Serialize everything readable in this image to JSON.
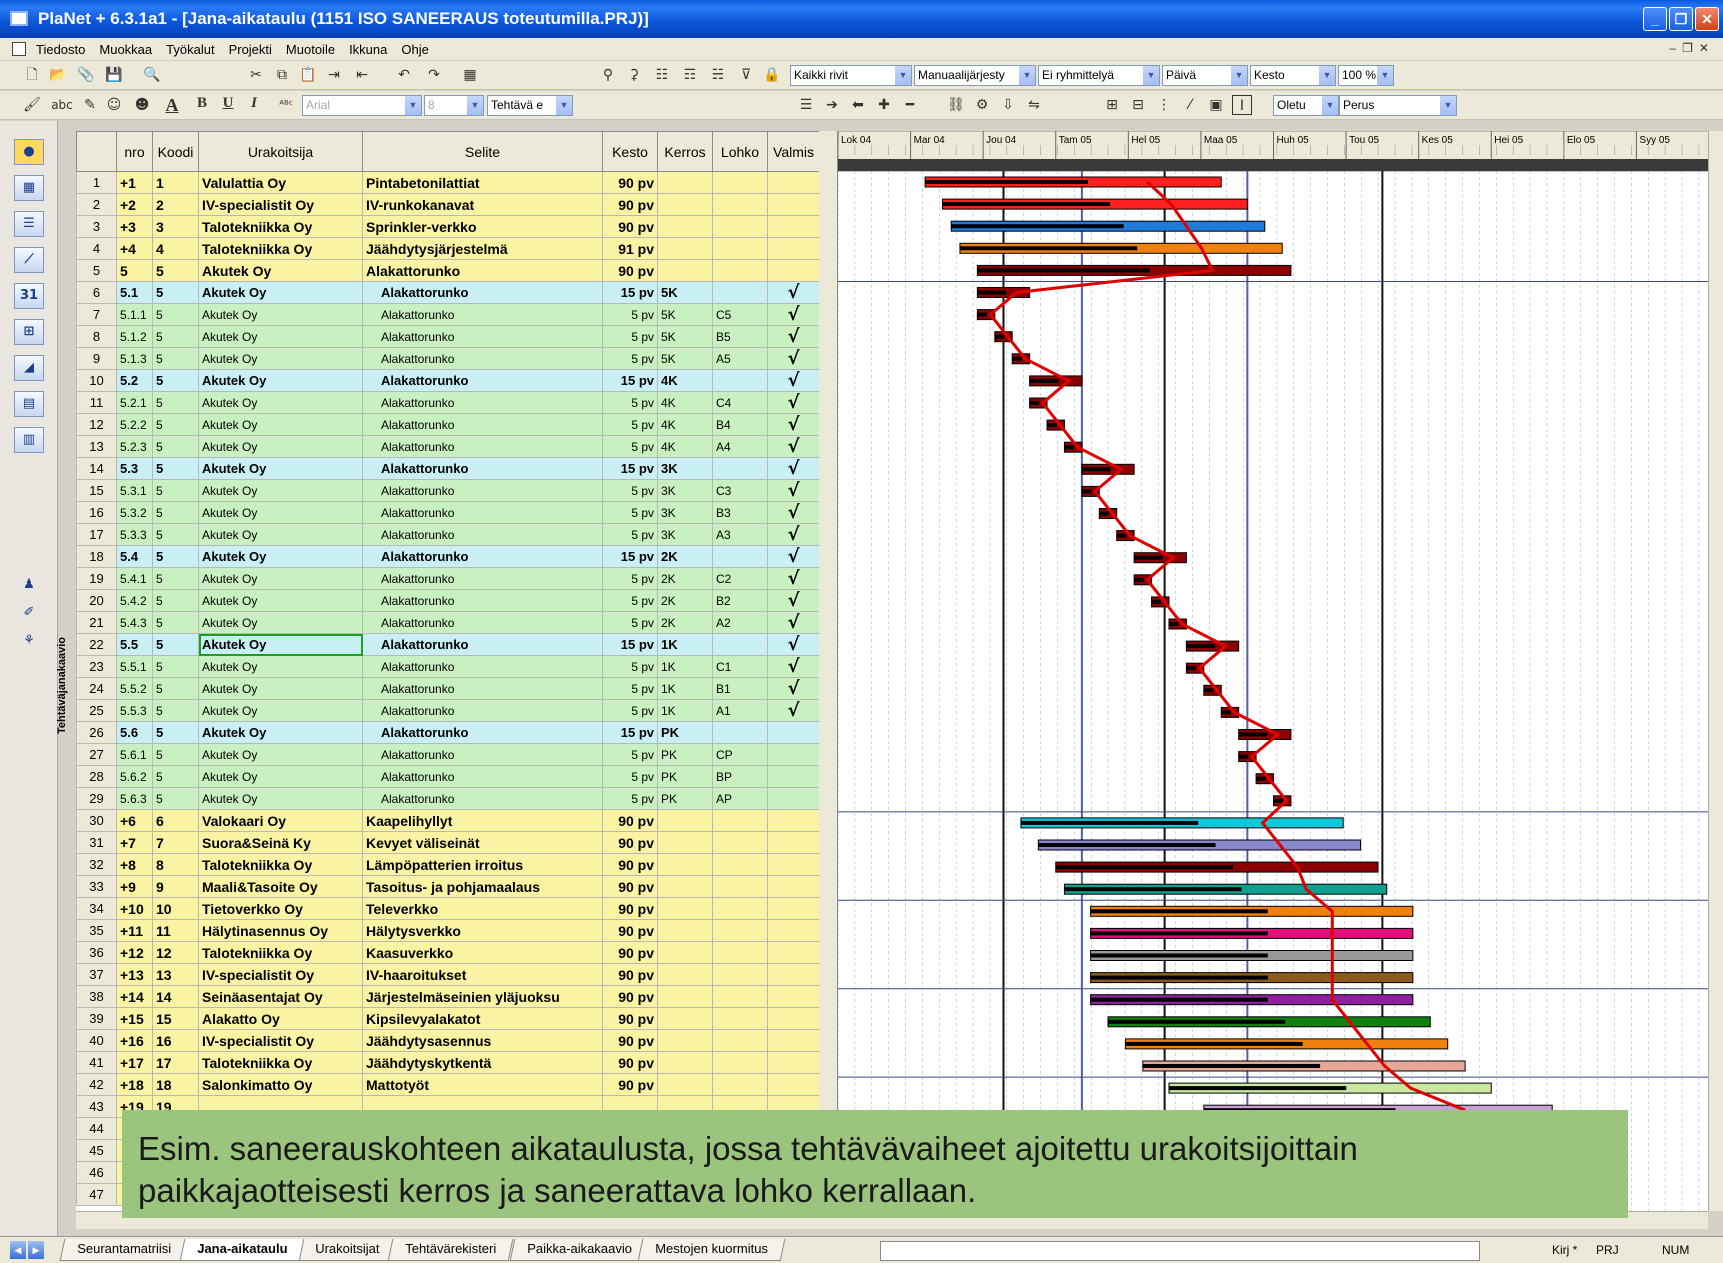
{
  "window": {
    "title": "PlaNet + 6.3.1a1 - [Jana-aikataulu (1151 ISO SANEERAUS toteutumilla.PRJ)]"
  },
  "menu": [
    "Tiedosto",
    "Muokkaa",
    "Työkalut",
    "Projekti",
    "Muotoile",
    "Ikkuna",
    "Ohje"
  ],
  "toolbar": {
    "rows_filter": "Kaikki rivit",
    "order": "Manuaalijärjesty",
    "grouping": "Ei ryhmittelyä",
    "time_unit": "Päivä",
    "column": "Kesto",
    "zoom": "100 %",
    "font": "Arial",
    "font_size": "8",
    "task_field": "Tehtävä e",
    "default_style": "Oletu",
    "base": "Perus"
  },
  "side_label": "Tehtäväjanakaavio",
  "table": {
    "headers": [
      "nro",
      "Koodi",
      "Urakoitsija",
      "Selite",
      "Kesto",
      "Kerros",
      "Lohko",
      "Valmis"
    ],
    "rows": [
      {
        "n": "1",
        "nro": "+1",
        "koodi": "1",
        "urak": "Valulattia Oy",
        "selite": "Pintabetonilattiat",
        "kesto": "90 pv",
        "kerros": "",
        "lohko": "",
        "valmis": "",
        "t": "main"
      },
      {
        "n": "2",
        "nro": "+2",
        "koodi": "2",
        "urak": "IV-specialistit Oy",
        "selite": "IV-runkokanavat",
        "kesto": "90 pv",
        "kerros": "",
        "lohko": "",
        "valmis": "",
        "t": "main"
      },
      {
        "n": "3",
        "nro": "+3",
        "koodi": "3",
        "urak": "Talotekniikka Oy",
        "selite": "Sprinkler-verkko",
        "kesto": "90 pv",
        "kerros": "",
        "lohko": "",
        "valmis": "",
        "t": "main"
      },
      {
        "n": "4",
        "nro": "+4",
        "koodi": "4",
        "urak": "Talotekniikka Oy",
        "selite": "Jäähdytysjärjestelmä",
        "kesto": "91 pv",
        "kerros": "",
        "lohko": "",
        "valmis": "",
        "t": "main"
      },
      {
        "n": "5",
        "nro": "5",
        "koodi": "5",
        "urak": "Akutek Oy",
        "selite": "Alakattorunko",
        "kesto": "90 pv",
        "kerros": "",
        "lohko": "",
        "valmis": "",
        "t": "main"
      },
      {
        "n": "6",
        "nro": "5.1",
        "koodi": "5",
        "urak": "Akutek Oy",
        "selite": "Alakattorunko",
        "kesto": "15 pv",
        "kerros": "5K",
        "lohko": "",
        "valmis": "√",
        "t": "group"
      },
      {
        "n": "7",
        "nro": "5.1.1",
        "koodi": "5",
        "urak": "Akutek Oy",
        "selite": "Alakattorunko",
        "kesto": "5 pv",
        "kerros": "5K",
        "lohko": "C5",
        "valmis": "√",
        "t": "sub"
      },
      {
        "n": "8",
        "nro": "5.1.2",
        "koodi": "5",
        "urak": "Akutek Oy",
        "selite": "Alakattorunko",
        "kesto": "5 pv",
        "kerros": "5K",
        "lohko": "B5",
        "valmis": "√",
        "t": "sub"
      },
      {
        "n": "9",
        "nro": "5.1.3",
        "koodi": "5",
        "urak": "Akutek Oy",
        "selite": "Alakattorunko",
        "kesto": "5 pv",
        "kerros": "5K",
        "lohko": "A5",
        "valmis": "√",
        "t": "sub"
      },
      {
        "n": "10",
        "nro": "5.2",
        "koodi": "5",
        "urak": "Akutek Oy",
        "selite": "Alakattorunko",
        "kesto": "15 pv",
        "kerros": "4K",
        "lohko": "",
        "valmis": "√",
        "t": "group"
      },
      {
        "n": "11",
        "nro": "5.2.1",
        "koodi": "5",
        "urak": "Akutek Oy",
        "selite": "Alakattorunko",
        "kesto": "5 pv",
        "kerros": "4K",
        "lohko": "C4",
        "valmis": "√",
        "t": "sub"
      },
      {
        "n": "12",
        "nro": "5.2.2",
        "koodi": "5",
        "urak": "Akutek Oy",
        "selite": "Alakattorunko",
        "kesto": "5 pv",
        "kerros": "4K",
        "lohko": "B4",
        "valmis": "√",
        "t": "sub"
      },
      {
        "n": "13",
        "nro": "5.2.3",
        "koodi": "5",
        "urak": "Akutek Oy",
        "selite": "Alakattorunko",
        "kesto": "5 pv",
        "kerros": "4K",
        "lohko": "A4",
        "valmis": "√",
        "t": "sub"
      },
      {
        "n": "14",
        "nro": "5.3",
        "koodi": "5",
        "urak": "Akutek Oy",
        "selite": "Alakattorunko",
        "kesto": "15 pv",
        "kerros": "3K",
        "lohko": "",
        "valmis": "√",
        "t": "group"
      },
      {
        "n": "15",
        "nro": "5.3.1",
        "koodi": "5",
        "urak": "Akutek Oy",
        "selite": "Alakattorunko",
        "kesto": "5 pv",
        "kerros": "3K",
        "lohko": "C3",
        "valmis": "√",
        "t": "sub"
      },
      {
        "n": "16",
        "nro": "5.3.2",
        "koodi": "5",
        "urak": "Akutek Oy",
        "selite": "Alakattorunko",
        "kesto": "5 pv",
        "kerros": "3K",
        "lohko": "B3",
        "valmis": "√",
        "t": "sub"
      },
      {
        "n": "17",
        "nro": "5.3.3",
        "koodi": "5",
        "urak": "Akutek Oy",
        "selite": "Alakattorunko",
        "kesto": "5 pv",
        "kerros": "3K",
        "lohko": "A3",
        "valmis": "√",
        "t": "sub"
      },
      {
        "n": "18",
        "nro": "5.4",
        "koodi": "5",
        "urak": "Akutek Oy",
        "selite": "Alakattorunko",
        "kesto": "15 pv",
        "kerros": "2K",
        "lohko": "",
        "valmis": "√",
        "t": "group"
      },
      {
        "n": "19",
        "nro": "5.4.1",
        "koodi": "5",
        "urak": "Akutek Oy",
        "selite": "Alakattorunko",
        "kesto": "5 pv",
        "kerros": "2K",
        "lohko": "C2",
        "valmis": "√",
        "t": "sub"
      },
      {
        "n": "20",
        "nro": "5.4.2",
        "koodi": "5",
        "urak": "Akutek Oy",
        "selite": "Alakattorunko",
        "kesto": "5 pv",
        "kerros": "2K",
        "lohko": "B2",
        "valmis": "√",
        "t": "sub"
      },
      {
        "n": "21",
        "nro": "5.4.3",
        "koodi": "5",
        "urak": "Akutek Oy",
        "selite": "Alakattorunko",
        "kesto": "5 pv",
        "kerros": "2K",
        "lohko": "A2",
        "valmis": "√",
        "t": "sub"
      },
      {
        "n": "22",
        "nro": "5.5",
        "koodi": "5",
        "urak": "Akutek Oy",
        "selite": "Alakattorunko",
        "kesto": "15 pv",
        "kerros": "1K",
        "lohko": "",
        "valmis": "√",
        "t": "group",
        "hl": true
      },
      {
        "n": "23",
        "nro": "5.5.1",
        "koodi": "5",
        "urak": "Akutek Oy",
        "selite": "Alakattorunko",
        "kesto": "5 pv",
        "kerros": "1K",
        "lohko": "C1",
        "valmis": "√",
        "t": "sub"
      },
      {
        "n": "24",
        "nro": "5.5.2",
        "koodi": "5",
        "urak": "Akutek Oy",
        "selite": "Alakattorunko",
        "kesto": "5 pv",
        "kerros": "1K",
        "lohko": "B1",
        "valmis": "√",
        "t": "sub"
      },
      {
        "n": "25",
        "nro": "5.5.3",
        "koodi": "5",
        "urak": "Akutek Oy",
        "selite": "Alakattorunko",
        "kesto": "5 pv",
        "kerros": "1K",
        "lohko": "A1",
        "valmis": "√",
        "t": "sub"
      },
      {
        "n": "26",
        "nro": "5.6",
        "koodi": "5",
        "urak": "Akutek Oy",
        "selite": "Alakattorunko",
        "kesto": "15 pv",
        "kerros": "PK",
        "lohko": "",
        "valmis": "",
        "t": "group"
      },
      {
        "n": "27",
        "nro": "5.6.1",
        "koodi": "5",
        "urak": "Akutek Oy",
        "selite": "Alakattorunko",
        "kesto": "5 pv",
        "kerros": "PK",
        "lohko": "CP",
        "valmis": "",
        "t": "sub"
      },
      {
        "n": "28",
        "nro": "5.6.2",
        "koodi": "5",
        "urak": "Akutek Oy",
        "selite": "Alakattorunko",
        "kesto": "5 pv",
        "kerros": "PK",
        "lohko": "BP",
        "valmis": "",
        "t": "sub"
      },
      {
        "n": "29",
        "nro": "5.6.3",
        "koodi": "5",
        "urak": "Akutek Oy",
        "selite": "Alakattorunko",
        "kesto": "5 pv",
        "kerros": "PK",
        "lohko": "AP",
        "valmis": "",
        "t": "sub"
      },
      {
        "n": "30",
        "nro": "+6",
        "koodi": "6",
        "urak": "Valokaari Oy",
        "selite": "Kaapelihyllyt",
        "kesto": "90 pv",
        "kerros": "",
        "lohko": "",
        "valmis": "",
        "t": "main"
      },
      {
        "n": "31",
        "nro": "+7",
        "koodi": "7",
        "urak": "Suora&Seinä Ky",
        "selite": "Kevyet väliseinät",
        "kesto": "90 pv",
        "kerros": "",
        "lohko": "",
        "valmis": "",
        "t": "main"
      },
      {
        "n": "32",
        "nro": "+8",
        "koodi": "8",
        "urak": "Talotekniikka Oy",
        "selite": "Lämpöpatterien irroitus",
        "kesto": "90 pv",
        "kerros": "",
        "lohko": "",
        "valmis": "",
        "t": "main"
      },
      {
        "n": "33",
        "nro": "+9",
        "koodi": "9",
        "urak": "Maali&Tasoite Oy",
        "selite": "Tasoitus- ja pohjamaalaus",
        "kesto": "90 pv",
        "kerros": "",
        "lohko": "",
        "valmis": "",
        "t": "main"
      },
      {
        "n": "34",
        "nro": "+10",
        "koodi": "10",
        "urak": "Tietoverkko Oy",
        "selite": "Televerkko",
        "kesto": "90 pv",
        "kerros": "",
        "lohko": "",
        "valmis": "",
        "t": "main"
      },
      {
        "n": "35",
        "nro": "+11",
        "koodi": "11",
        "urak": "Hälytinasennus Oy",
        "selite": "Hälytysverkko",
        "kesto": "90 pv",
        "kerros": "",
        "lohko": "",
        "valmis": "",
        "t": "main"
      },
      {
        "n": "36",
        "nro": "+12",
        "koodi": "12",
        "urak": "Talotekniikka Oy",
        "selite": "Kaasuverkko",
        "kesto": "90 pv",
        "kerros": "",
        "lohko": "",
        "valmis": "",
        "t": "main"
      },
      {
        "n": "37",
        "nro": "+13",
        "koodi": "13",
        "urak": "IV-specialistit Oy",
        "selite": "IV-haaroitukset",
        "kesto": "90 pv",
        "kerros": "",
        "lohko": "",
        "valmis": "",
        "t": "main"
      },
      {
        "n": "38",
        "nro": "+14",
        "koodi": "14",
        "urak": "Seinäasentajat Oy",
        "selite": "Järjestelmäseinien yläjuoksu",
        "kesto": "90 pv",
        "kerros": "",
        "lohko": "",
        "valmis": "",
        "t": "main"
      },
      {
        "n": "39",
        "nro": "+15",
        "koodi": "15",
        "urak": "Alakatto Oy",
        "selite": "Kipsilevyalakatot",
        "kesto": "90 pv",
        "kerros": "",
        "lohko": "",
        "valmis": "",
        "t": "main"
      },
      {
        "n": "40",
        "nro": "+16",
        "koodi": "16",
        "urak": "IV-specialistit Oy",
        "selite": "Jäähdytysasennus",
        "kesto": "90 pv",
        "kerros": "",
        "lohko": "",
        "valmis": "",
        "t": "main"
      },
      {
        "n": "41",
        "nro": "+17",
        "koodi": "17",
        "urak": "Talotekniikka Oy",
        "selite": "Jäähdytyskytkentä",
        "kesto": "90 pv",
        "kerros": "",
        "lohko": "",
        "valmis": "",
        "t": "main"
      },
      {
        "n": "42",
        "nro": "+18",
        "koodi": "18",
        "urak": "Salonkimatto Oy",
        "selite": "Mattotyöt",
        "kesto": "90 pv",
        "kerros": "",
        "lohko": "",
        "valmis": "",
        "t": "main"
      },
      {
        "n": "43",
        "nro": "+19",
        "koodi": "19",
        "urak": "",
        "selite": "",
        "kesto": "",
        "kerros": "",
        "lohko": "",
        "valmis": "",
        "t": "main"
      },
      {
        "n": "44",
        "nro": "",
        "koodi": "",
        "urak": "",
        "selite": "",
        "kesto": "",
        "kerros": "",
        "lohko": "",
        "valmis": "",
        "t": "main"
      },
      {
        "n": "45",
        "nro": "",
        "koodi": "",
        "urak": "",
        "selite": "",
        "kesto": "",
        "kerros": "",
        "lohko": "",
        "valmis": "",
        "t": "main"
      },
      {
        "n": "46",
        "nro": "",
        "koodi": "",
        "urak": "",
        "selite": "",
        "kesto": "",
        "kerros": "",
        "lohko": "",
        "valmis": "",
        "t": "main"
      },
      {
        "n": "47",
        "nro": "",
        "koodi": "",
        "urak": "",
        "selite": "",
        "kesto": "",
        "kerros": "",
        "lohko": "",
        "valmis": "",
        "t": "main"
      }
    ]
  },
  "gantt": {
    "months": [
      "Lok 04",
      "Mar 04",
      "Jou 04",
      "Tam 05",
      "Hel 05",
      "Maa 05",
      "Huh 05",
      "Tou 05",
      "Kes 05",
      "Hei 05",
      "Elo 05",
      "Syy 05"
    ],
    "colors": {
      "bar": "#1a1a1a",
      "crit": "#8b0000",
      "progress": "#e00000",
      "grid": "#9aa8d0"
    },
    "bars": [
      {
        "r": 0,
        "s": 0.1,
        "e": 0.44,
        "c": "#ff2020"
      },
      {
        "r": 1,
        "s": 0.12,
        "e": 0.47,
        "c": "#ff2020"
      },
      {
        "r": 2,
        "s": 0.13,
        "e": 0.49,
        "c": "#1f7bd8"
      },
      {
        "r": 3,
        "s": 0.14,
        "e": 0.51,
        "c": "#f08010"
      },
      {
        "r": 4,
        "s": 0.16,
        "e": 0.52,
        "c": "#8b0000"
      },
      {
        "r": 5,
        "s": 0.16,
        "e": 0.22,
        "c": "#8b0000"
      },
      {
        "r": 6,
        "s": 0.16,
        "e": 0.18,
        "c": "#8b0000"
      },
      {
        "r": 7,
        "s": 0.18,
        "e": 0.2,
        "c": "#8b0000"
      },
      {
        "r": 8,
        "s": 0.2,
        "e": 0.22,
        "c": "#8b0000"
      },
      {
        "r": 9,
        "s": 0.22,
        "e": 0.28,
        "c": "#8b0000"
      },
      {
        "r": 10,
        "s": 0.22,
        "e": 0.24,
        "c": "#8b0000"
      },
      {
        "r": 11,
        "s": 0.24,
        "e": 0.26,
        "c": "#8b0000"
      },
      {
        "r": 12,
        "s": 0.26,
        "e": 0.28,
        "c": "#8b0000"
      },
      {
        "r": 13,
        "s": 0.28,
        "e": 0.34,
        "c": "#8b0000"
      },
      {
        "r": 14,
        "s": 0.28,
        "e": 0.3,
        "c": "#8b0000"
      },
      {
        "r": 15,
        "s": 0.3,
        "e": 0.32,
        "c": "#8b0000"
      },
      {
        "r": 16,
        "s": 0.32,
        "e": 0.34,
        "c": "#8b0000"
      },
      {
        "r": 17,
        "s": 0.34,
        "e": 0.4,
        "c": "#8b0000"
      },
      {
        "r": 18,
        "s": 0.34,
        "e": 0.36,
        "c": "#8b0000"
      },
      {
        "r": 19,
        "s": 0.36,
        "e": 0.38,
        "c": "#8b0000"
      },
      {
        "r": 20,
        "s": 0.38,
        "e": 0.4,
        "c": "#8b0000"
      },
      {
        "r": 21,
        "s": 0.4,
        "e": 0.46,
        "c": "#8b0000"
      },
      {
        "r": 22,
        "s": 0.4,
        "e": 0.42,
        "c": "#8b0000"
      },
      {
        "r": 23,
        "s": 0.42,
        "e": 0.44,
        "c": "#8b0000"
      },
      {
        "r": 24,
        "s": 0.44,
        "e": 0.46,
        "c": "#8b0000"
      },
      {
        "r": 25,
        "s": 0.46,
        "e": 0.52,
        "c": "#8b0000"
      },
      {
        "r": 26,
        "s": 0.46,
        "e": 0.48,
        "c": "#8b0000"
      },
      {
        "r": 27,
        "s": 0.48,
        "e": 0.5,
        "c": "#8b0000"
      },
      {
        "r": 28,
        "s": 0.5,
        "e": 0.52,
        "c": "#8b0000"
      },
      {
        "r": 29,
        "s": 0.21,
        "e": 0.58,
        "c": "#10c8d8"
      },
      {
        "r": 30,
        "s": 0.23,
        "e": 0.6,
        "c": "#8888cc"
      },
      {
        "r": 31,
        "s": 0.25,
        "e": 0.62,
        "c": "#8b0000"
      },
      {
        "r": 32,
        "s": 0.26,
        "e": 0.63,
        "c": "#10a090"
      },
      {
        "r": 33,
        "s": 0.29,
        "e": 0.66,
        "c": "#f08010"
      },
      {
        "r": 34,
        "s": 0.29,
        "e": 0.66,
        "c": "#e0107a"
      },
      {
        "r": 35,
        "s": 0.29,
        "e": 0.66,
        "c": "#999999"
      },
      {
        "r": 36,
        "s": 0.29,
        "e": 0.66,
        "c": "#8b5a1a"
      },
      {
        "r": 37,
        "s": 0.29,
        "e": 0.66,
        "c": "#9020a0"
      },
      {
        "r": 38,
        "s": 0.31,
        "e": 0.68,
        "c": "#108010"
      },
      {
        "r": 39,
        "s": 0.33,
        "e": 0.7,
        "c": "#f08010"
      },
      {
        "r": 40,
        "s": 0.35,
        "e": 0.72,
        "c": "#e8a898"
      },
      {
        "r": 41,
        "s": 0.38,
        "e": 0.75,
        "c": "#c8e8a0"
      },
      {
        "r": 42,
        "s": 0.42,
        "e": 0.82,
        "c": "#c8a0d8"
      }
    ]
  },
  "caption": {
    "line1": "Esim. saneerauskohteen aikataulusta, jossa tehtävävaiheet ajoitettu urakoitsijoittain",
    "line2": "paikkajaotteisesti kerros ja saneerattava lohko kerrallaan."
  },
  "tabs": [
    "Seurantamatriisi",
    "Jana-aikataulu",
    "Urakoitsijat",
    "Tehtävärekisteri",
    "Paikka-aikakaavio",
    "Mestojen kuormitus"
  ],
  "active_tab": "Jana-aikataulu",
  "status": {
    "mode": "Kirj *",
    "file": "PRJ",
    "num": "NUM"
  }
}
